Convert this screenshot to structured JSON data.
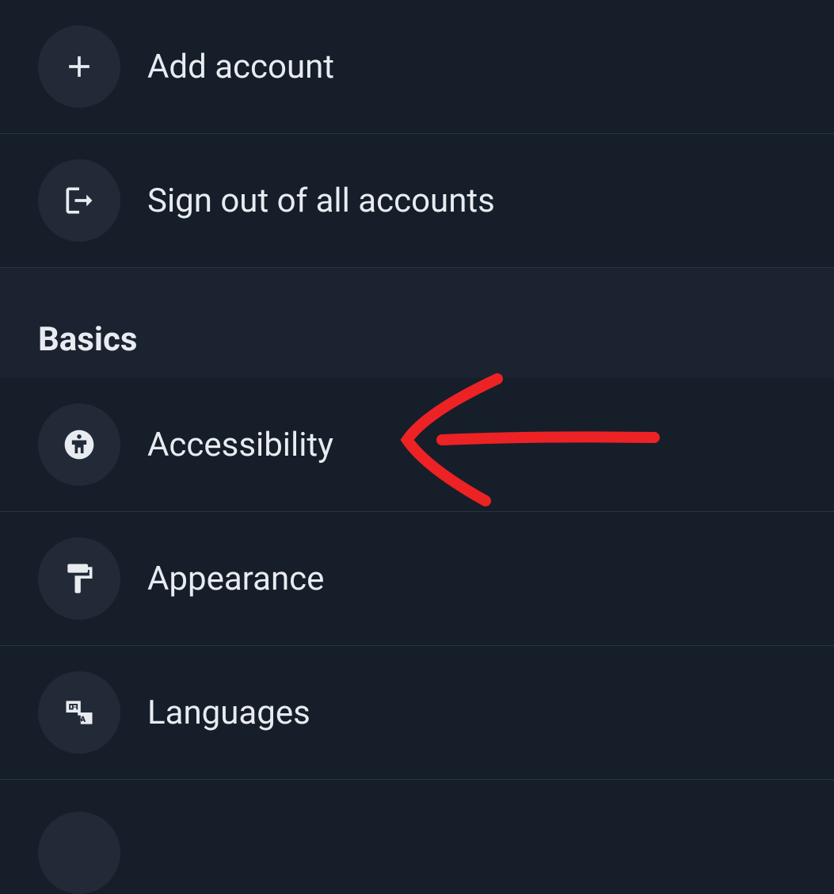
{
  "account_section": {
    "add_account": "Add account",
    "sign_out": "Sign out of all accounts"
  },
  "basics_section": {
    "title": "Basics",
    "items": [
      {
        "label": "Accessibility"
      },
      {
        "label": "Appearance"
      },
      {
        "label": "Languages"
      }
    ]
  },
  "annotation": {
    "type": "arrow",
    "color": "#ed2224",
    "points_to": "accessibility"
  }
}
